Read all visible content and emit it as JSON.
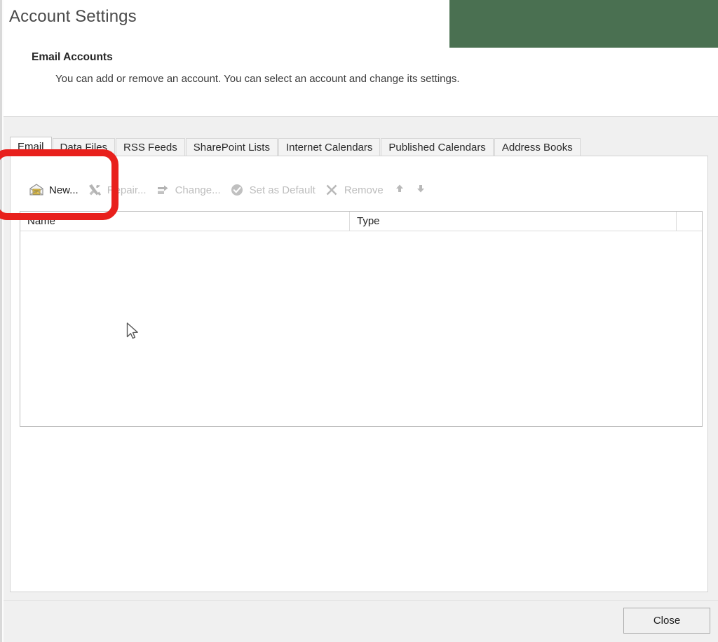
{
  "window": {
    "title": "Account Settings"
  },
  "header": {
    "section_title": "Email Accounts",
    "section_description": "You can add or remove an account. You can select an account and change its settings."
  },
  "tabs": [
    {
      "label": "Email",
      "selected": true
    },
    {
      "label": "Data Files",
      "selected": false
    },
    {
      "label": "RSS Feeds",
      "selected": false
    },
    {
      "label": "SharePoint Lists",
      "selected": false
    },
    {
      "label": "Internet Calendars",
      "selected": false
    },
    {
      "label": "Published Calendars",
      "selected": false
    },
    {
      "label": "Address Books",
      "selected": false
    }
  ],
  "toolbar": {
    "new": {
      "label": "New...",
      "icon": "new-mail-icon",
      "enabled": true
    },
    "repair": {
      "label": "Repair...",
      "icon": "wrench-hammer-icon",
      "enabled": false
    },
    "change": {
      "label": "Change...",
      "icon": "change-icon",
      "enabled": false
    },
    "set_as_default": {
      "label": "Set as Default",
      "icon": "check-circle-icon",
      "enabled": false
    },
    "remove": {
      "label": "Remove",
      "icon": "x-icon",
      "enabled": false
    },
    "move_up": {
      "label": "",
      "icon": "arrow-up-icon",
      "enabled": false
    },
    "move_down": {
      "label": "",
      "icon": "arrow-down-icon",
      "enabled": false
    }
  },
  "accounts_list": {
    "columns": [
      "Name",
      "Type"
    ],
    "rows": []
  },
  "footer": {
    "close_label": "Close"
  },
  "annotation": {
    "color": "#e8201c",
    "target": "new-button"
  },
  "decor": {
    "green_block_color": "#4a7051"
  }
}
